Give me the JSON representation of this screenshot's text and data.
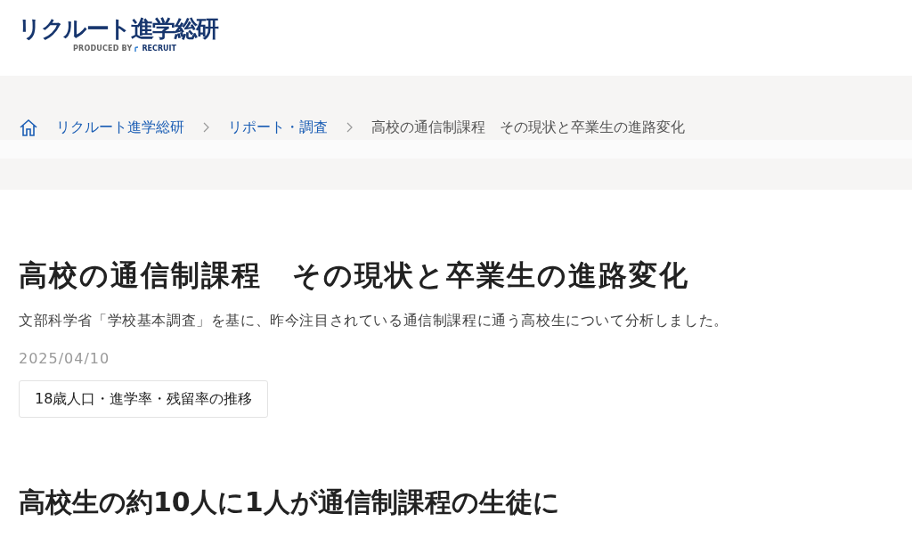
{
  "header": {
    "logo": "リクルート進学総研",
    "produced_by": "PRODUCED BY",
    "brand": "RECRUIT"
  },
  "breadcrumb": [
    {
      "label": "リクルート進学総研",
      "kind": "link"
    },
    {
      "label": "リポート・調査",
      "kind": "link"
    },
    {
      "label": "高校の通信制課程　その現状と卒業生の進路変化",
      "kind": "current"
    }
  ],
  "article": {
    "title": "高校の通信制課程　その現状と卒業生の進路変化",
    "lead": "文部科学省「学校基本調査」を基に、昨今注目されている通信制課程に通う高校生について分析しました。",
    "date": "2025/04/10",
    "tags": [
      "18歳人口・進学率・残留率の推移"
    ],
    "section_heading": "高校生の約10人に1人が通信制課程の生徒に"
  }
}
